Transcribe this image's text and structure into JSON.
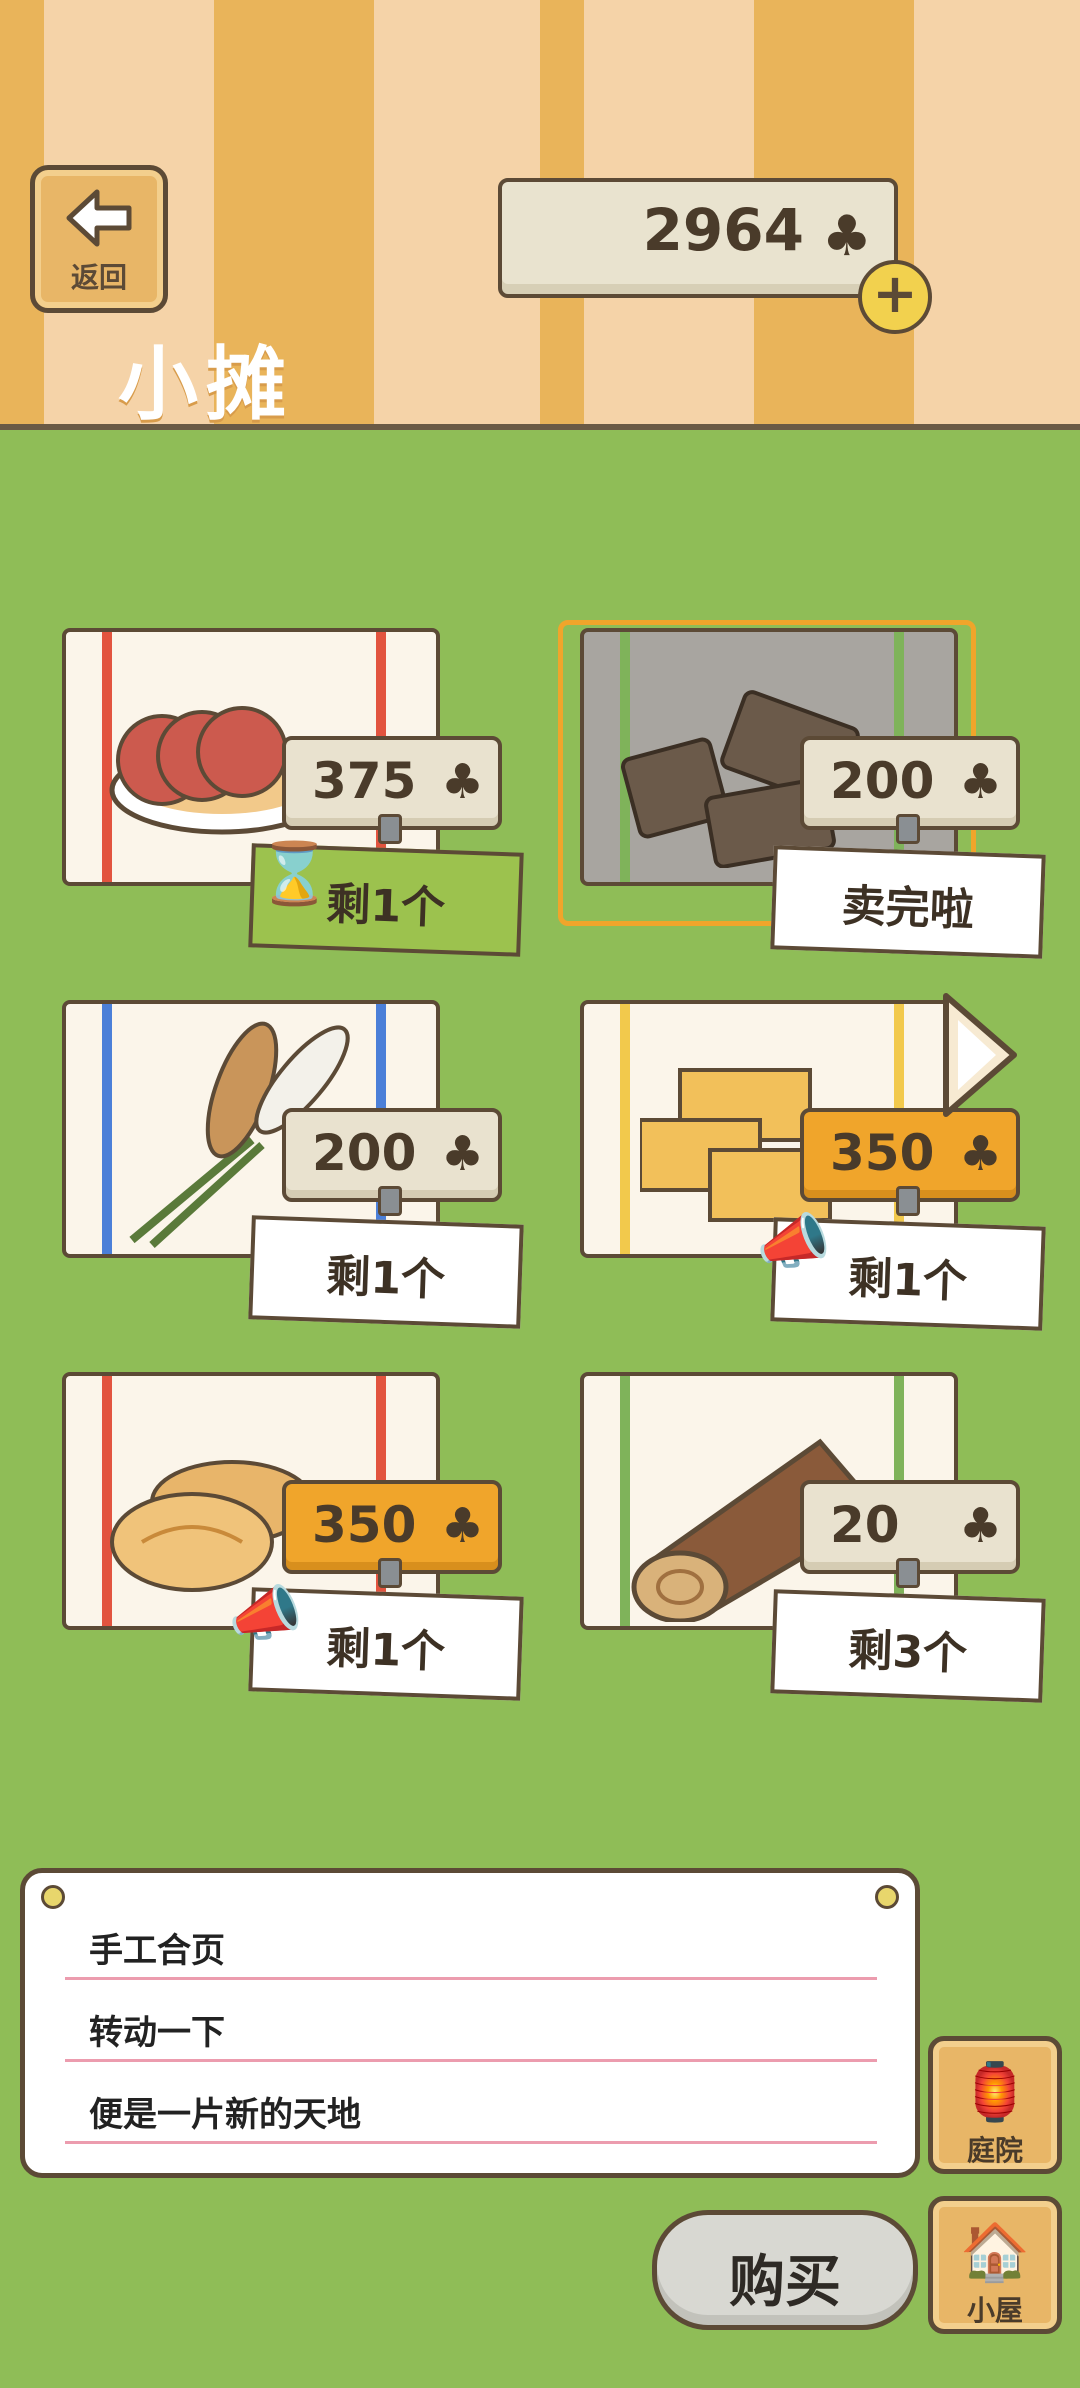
{
  "header": {
    "back_label": "返回",
    "title": "小摊",
    "coins": "2964",
    "coin_icon": "clover-icon",
    "add_icon": "plus-icon"
  },
  "items": [
    {
      "name": "sausage",
      "price": "375",
      "stock": "剩1个",
      "tag_style": "normal",
      "stock_style": "timer",
      "icon": "sausage-plate-icon",
      "stripe_color": "#e2543f"
    },
    {
      "name": "hinge",
      "price": "200",
      "stock": "卖完啦",
      "tag_style": "normal",
      "stock_style": "sold-out",
      "icon": "hinge-icon",
      "stripe_color": "#7fb35a"
    },
    {
      "name": "reed",
      "price": "200",
      "stock": "剩1个",
      "tag_style": "normal",
      "stock_style": "plain",
      "icon": "reed-bundle-icon",
      "stripe_color": "#4b7fd8"
    },
    {
      "name": "castella",
      "price": "350",
      "stock": "剩1个",
      "tag_style": "hot",
      "stock_style": "promo",
      "icon": "castella-cake-icon",
      "stripe_color": "#f2c94c"
    },
    {
      "name": "pastry",
      "price": "350",
      "stock": "剩1个",
      "tag_style": "hot",
      "stock_style": "promo",
      "icon": "pastry-icon",
      "stripe_color": "#e2543f"
    },
    {
      "name": "log",
      "price": "20",
      "stock": "剩3个",
      "tag_style": "normal",
      "stock_style": "plain",
      "icon": "log-icon",
      "stripe_color": "#7fb35a"
    }
  ],
  "description": {
    "lines": [
      "手工合页",
      "转动一下",
      "便是一片新的天地"
    ]
  },
  "buttons": {
    "buy": "购买",
    "yard": "庭院",
    "house": "小屋"
  }
}
